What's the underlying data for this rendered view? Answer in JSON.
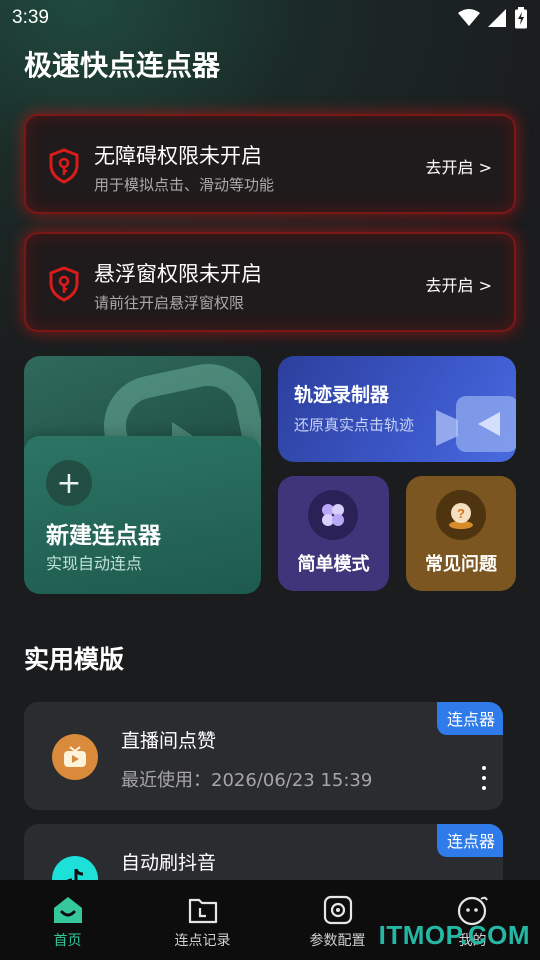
{
  "status_bar": {
    "time": "3:39"
  },
  "app_title": "极速快点连点器",
  "permissions": [
    {
      "title": "无障碍权限未开启",
      "subtitle": "用于模拟点击、滑动等功能",
      "action": "去开启 >"
    },
    {
      "title": "悬浮窗权限未开启",
      "subtitle": "请前往开启悬浮窗权限",
      "action": "去开启 >"
    }
  ],
  "tiles": {
    "new_clicker": {
      "title": "新建连点器",
      "subtitle": "实现自动连点",
      "icon": "plus-icon"
    },
    "track_recorder": {
      "title": "轨迹录制器",
      "subtitle": "还原真实点击轨迹",
      "icon": "video-camera-icon"
    },
    "simple_mode": {
      "label": "简单模式",
      "icon": "clover-icon"
    },
    "faq": {
      "label": "常见问题",
      "icon": "question-bubble-icon"
    }
  },
  "templates_section": {
    "title": "实用模版",
    "items": [
      {
        "name": "直播间点赞",
        "recent": "最近使用：2026/06/23 15:39",
        "badge": "连点器",
        "icon": "tv-icon"
      },
      {
        "name": "自动刷抖音",
        "recent": "",
        "badge": "连点器",
        "icon": "tiktok-icon"
      }
    ]
  },
  "bottom_nav": [
    {
      "label": "首页",
      "icon": "home-icon",
      "active": true
    },
    {
      "label": "连点记录",
      "icon": "folder-icon",
      "active": false
    },
    {
      "label": "参数配置",
      "icon": "settings-icon",
      "active": false
    },
    {
      "label": "我的",
      "icon": "profile-icon",
      "active": false
    }
  ],
  "watermark": "ITMOP.COM",
  "colors": {
    "accent_green": "#33c79a",
    "warning_red": "#c41414",
    "badge_blue": "#2f7bea",
    "simple_mode_bg": "#40357a",
    "faq_bg": "#7b5620"
  }
}
